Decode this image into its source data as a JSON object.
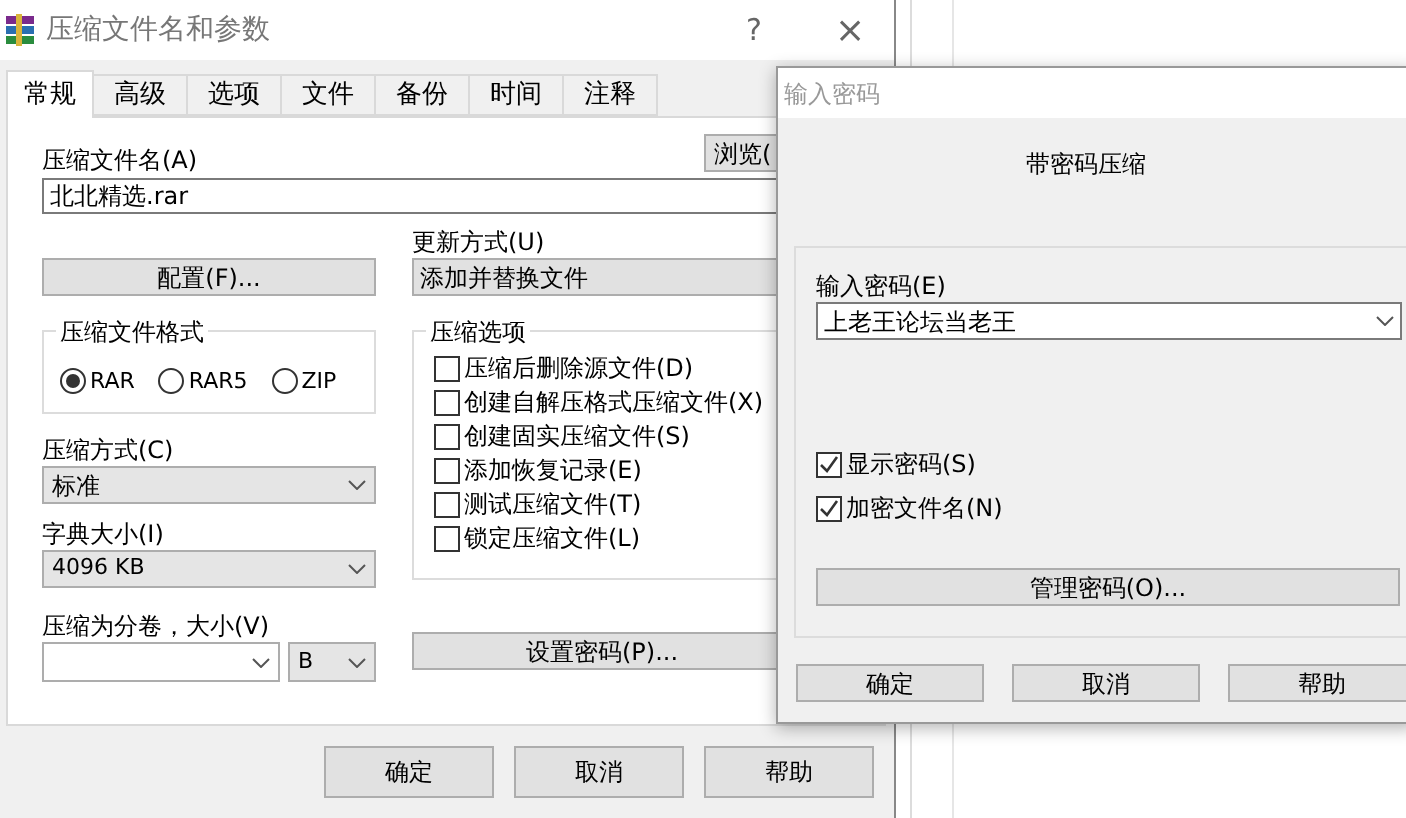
{
  "main_dialog": {
    "title": "压缩文件名和参数",
    "help_button": "?",
    "close_button": "×",
    "tabs": [
      {
        "label": "常规",
        "selected": true
      },
      {
        "label": "高级",
        "selected": false
      },
      {
        "label": "选项",
        "selected": false
      },
      {
        "label": "文件",
        "selected": false
      },
      {
        "label": "备份",
        "selected": false
      },
      {
        "label": "时间",
        "selected": false
      },
      {
        "label": "注释",
        "selected": false
      }
    ],
    "archive_name": {
      "label": "压缩文件名(A)",
      "value": "北北精选.rar"
    },
    "browse_button": "浏览(",
    "profiles_button": "配置(F)...",
    "update_mode": {
      "label": "更新方式(U)",
      "value": "添加并替换文件"
    },
    "format": {
      "title": "压缩文件格式",
      "options": [
        {
          "label": "RAR",
          "selected": true
        },
        {
          "label": "RAR5",
          "selected": false
        },
        {
          "label": "ZIP",
          "selected": false
        }
      ]
    },
    "method": {
      "label": "压缩方式(C)",
      "value": "标准"
    },
    "dictionary": {
      "label": "字典大小(I)",
      "value": "4096 KB"
    },
    "split": {
      "label": "压缩为分卷，大小(V)",
      "unit": "B"
    },
    "options": {
      "title": "压缩选项",
      "items": [
        {
          "label": "压缩后删除源文件(D)",
          "checked": false
        },
        {
          "label": "创建自解压格式压缩文件(X)",
          "checked": false
        },
        {
          "label": "创建固实压缩文件(S)",
          "checked": false
        },
        {
          "label": "添加恢复记录(E)",
          "checked": false
        },
        {
          "label": "测试压缩文件(T)",
          "checked": false
        },
        {
          "label": "锁定压缩文件(L)",
          "checked": false
        }
      ]
    },
    "set_password_button": "设置密码(P)...",
    "buttons": [
      "确定",
      "取消",
      "帮助"
    ]
  },
  "password_dialog": {
    "title": "输入密码",
    "heading": "带密码压缩",
    "password": {
      "label": "输入密码(E)",
      "value": "上老王论坛当老王"
    },
    "checkboxes": [
      {
        "label": "显示密码(S)",
        "checked": true
      },
      {
        "label": "加密文件名(N)",
        "checked": true
      }
    ],
    "manage_button": "管理密码(O)...",
    "buttons": [
      "确定",
      "取消",
      "帮助"
    ]
  }
}
